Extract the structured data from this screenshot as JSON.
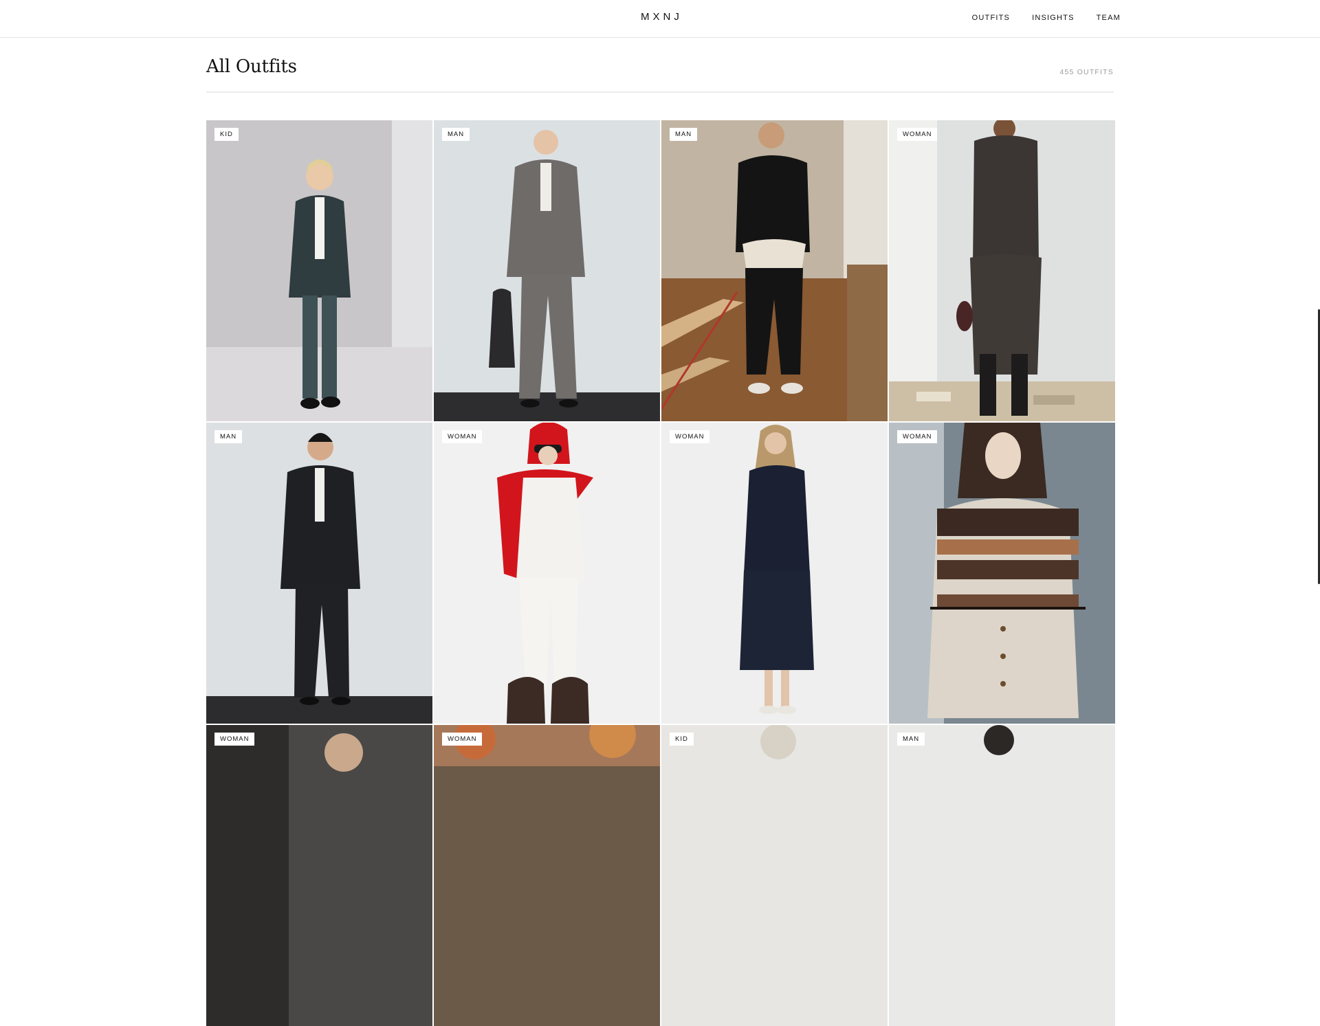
{
  "brand": "MXNJ",
  "nav": [
    "OUTFITS",
    "INSIGHTS",
    "TEAM"
  ],
  "page": {
    "title": "All Outfits",
    "count": "455 OUTFITS"
  },
  "outfits": [
    {
      "tag": "KID"
    },
    {
      "tag": "MAN"
    },
    {
      "tag": "MAN"
    },
    {
      "tag": "WOMAN"
    },
    {
      "tag": "MAN"
    },
    {
      "tag": "WOMAN"
    },
    {
      "tag": "WOMAN"
    },
    {
      "tag": "WOMAN"
    },
    {
      "tag": "WOMAN"
    },
    {
      "tag": "WOMAN"
    },
    {
      "tag": "KID"
    },
    {
      "tag": "MAN"
    }
  ]
}
